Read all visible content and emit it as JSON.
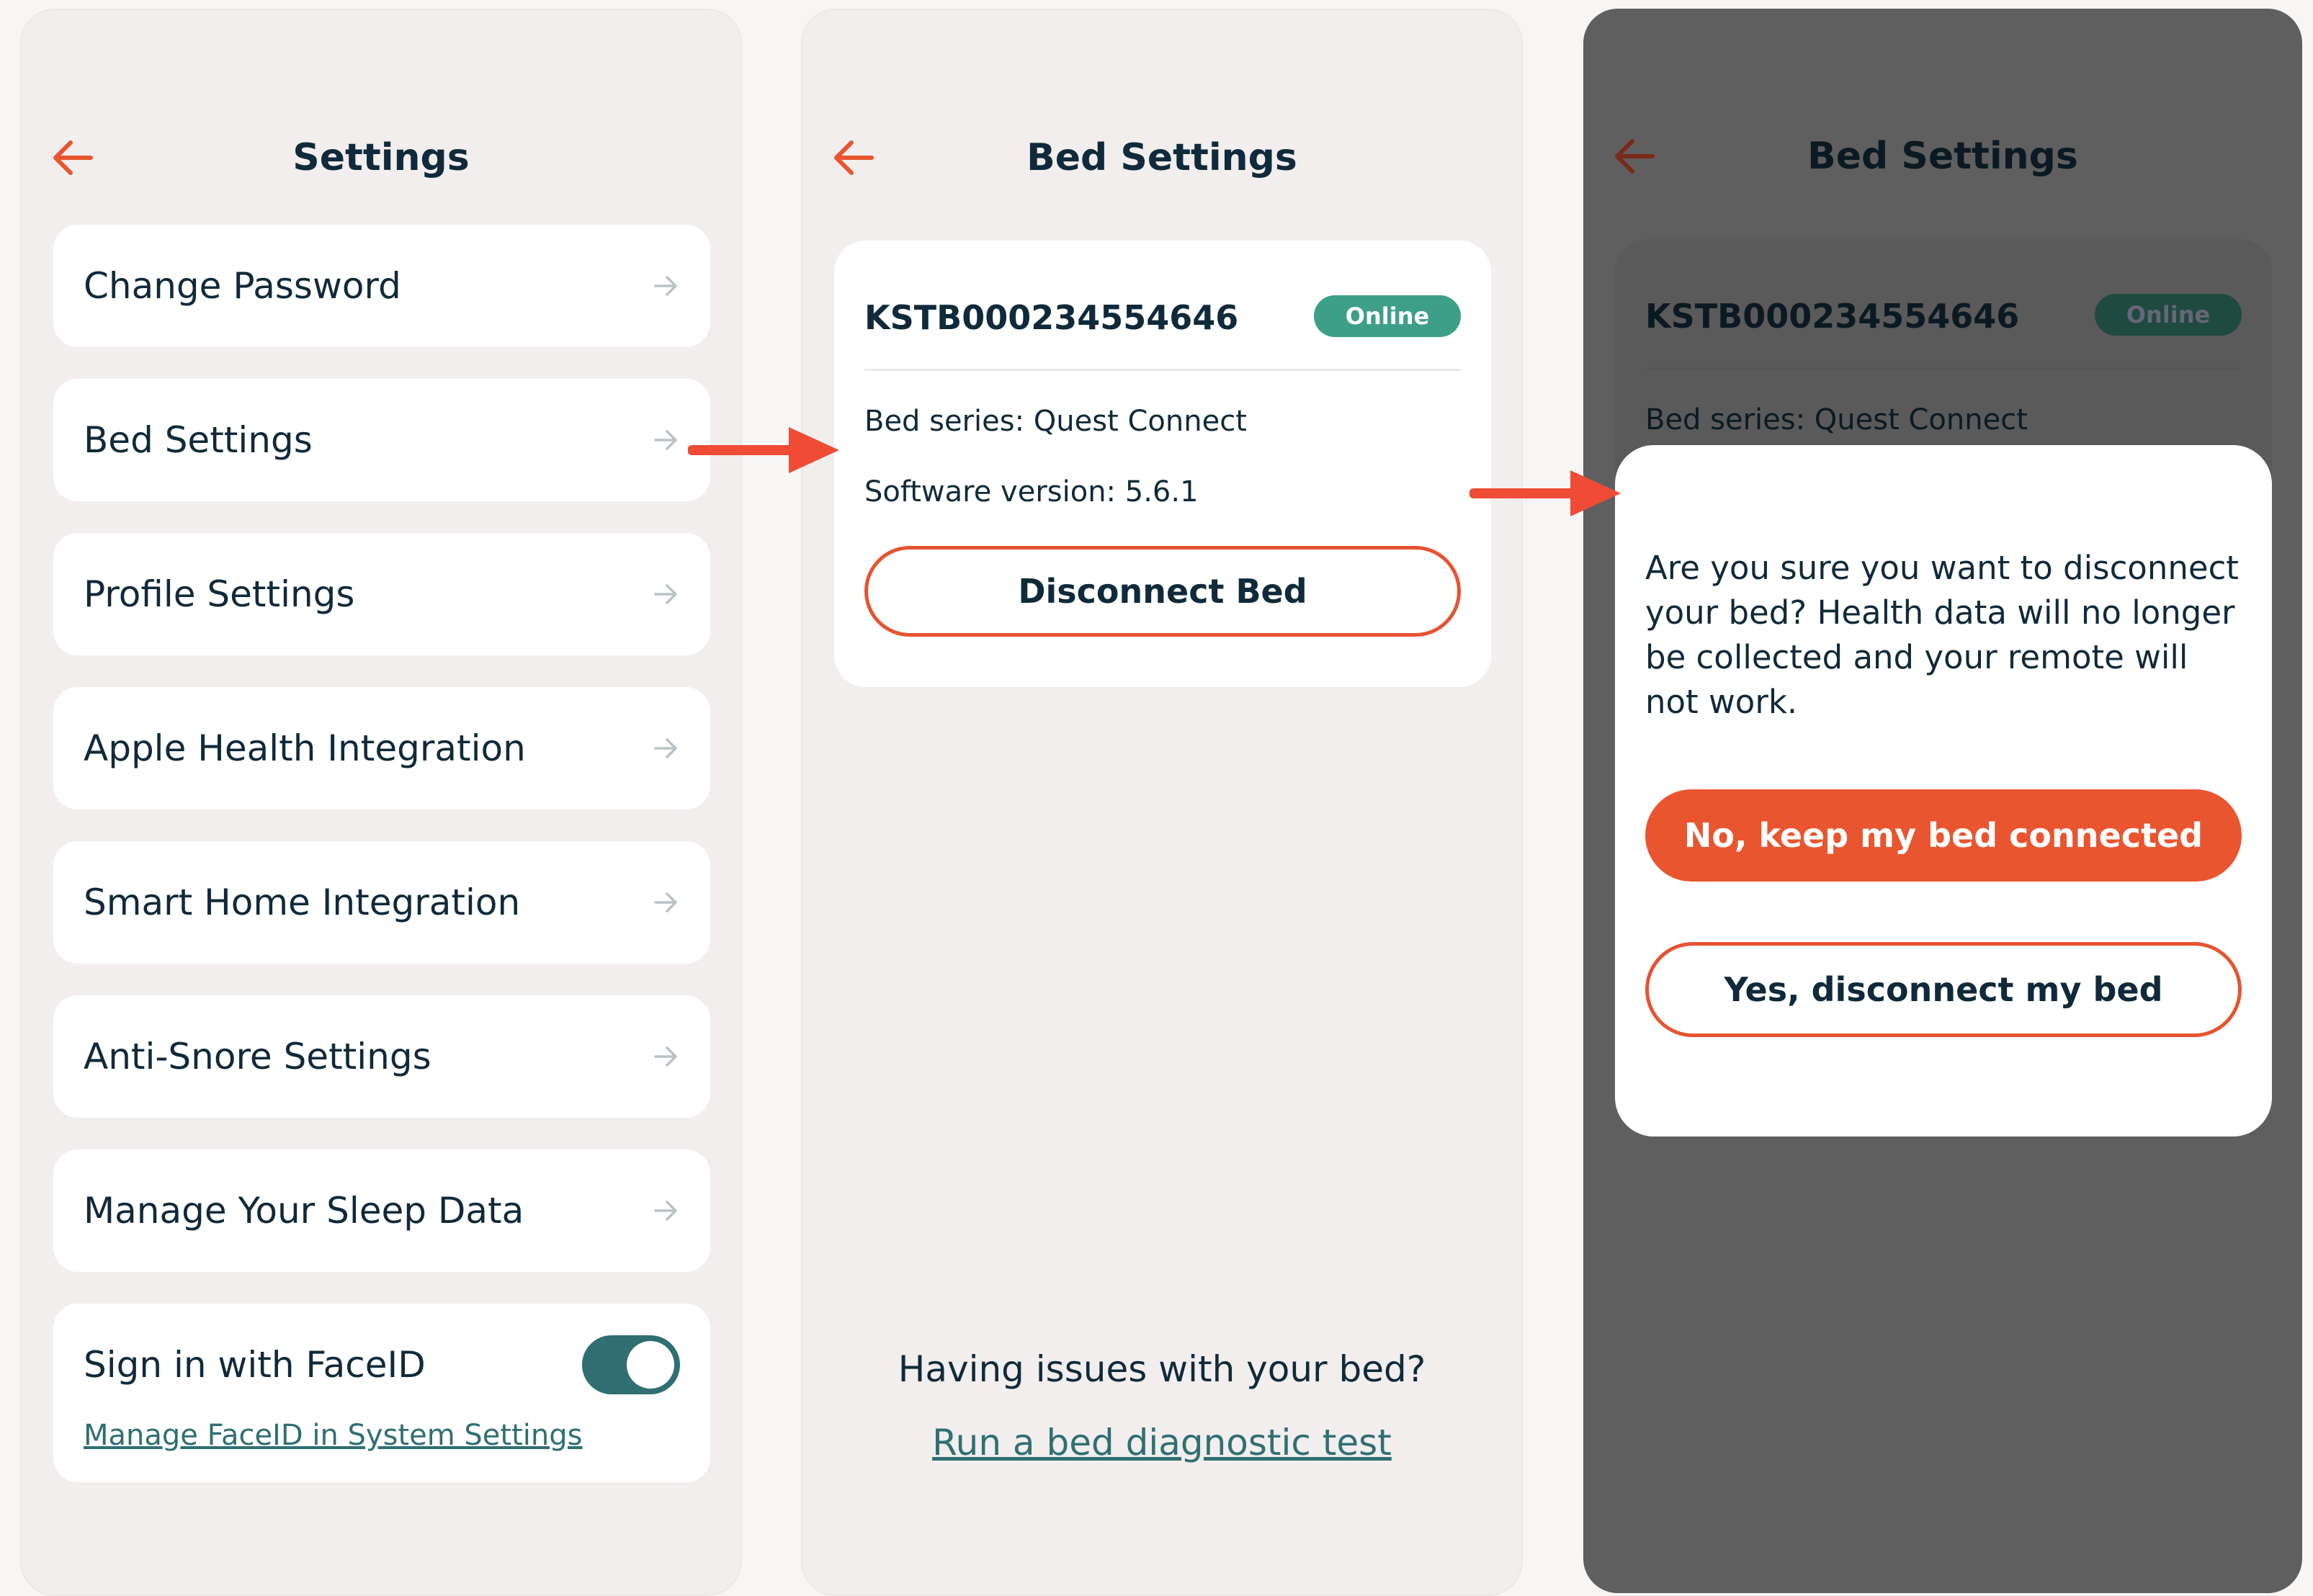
{
  "colors": {
    "accent": "#e9552f",
    "navy": "#0f2a3a",
    "teal": "#2f6f72",
    "online_green": "#3e9f89",
    "panel_bg": "#f1eeed",
    "overlay": "#5f5f5f"
  },
  "settings_screen": {
    "title": "Settings",
    "back_icon": "arrow-left-icon",
    "items": [
      {
        "label": "Change Password",
        "icon": "arrow-right-icon"
      },
      {
        "label": "Bed Settings",
        "icon": "arrow-right-icon"
      },
      {
        "label": "Profile Settings",
        "icon": "arrow-right-icon"
      },
      {
        "label": "Apple Health Integration",
        "icon": "arrow-right-icon"
      },
      {
        "label": "Smart Home Integration",
        "icon": "arrow-right-icon"
      },
      {
        "label": "Anti-Snore Settings",
        "icon": "arrow-right-icon"
      },
      {
        "label": "Manage Your Sleep Data",
        "icon": "arrow-right-icon"
      }
    ],
    "faceid": {
      "label": "Sign in with FaceID",
      "toggle_on": true,
      "link": "Manage FaceID in System Settings"
    }
  },
  "bed_settings_screen": {
    "title": "Bed Settings",
    "serial": "KSTB000234554646",
    "status": "Online",
    "bed_series": "Bed series: Quest Connect",
    "software_version": "Software version: 5.6.1",
    "disconnect_button": "Disconnect Bed",
    "issues_text": "Having issues with your bed?",
    "diagnostic_link": "Run a bed diagnostic test"
  },
  "confirm_dialog": {
    "message": "Are you sure you want to disconnect your bed?  Health data will no longer be collected and your remote will not work.",
    "keep_button": "No, keep my bed connected",
    "confirm_button": "Yes, disconnect my bed"
  }
}
